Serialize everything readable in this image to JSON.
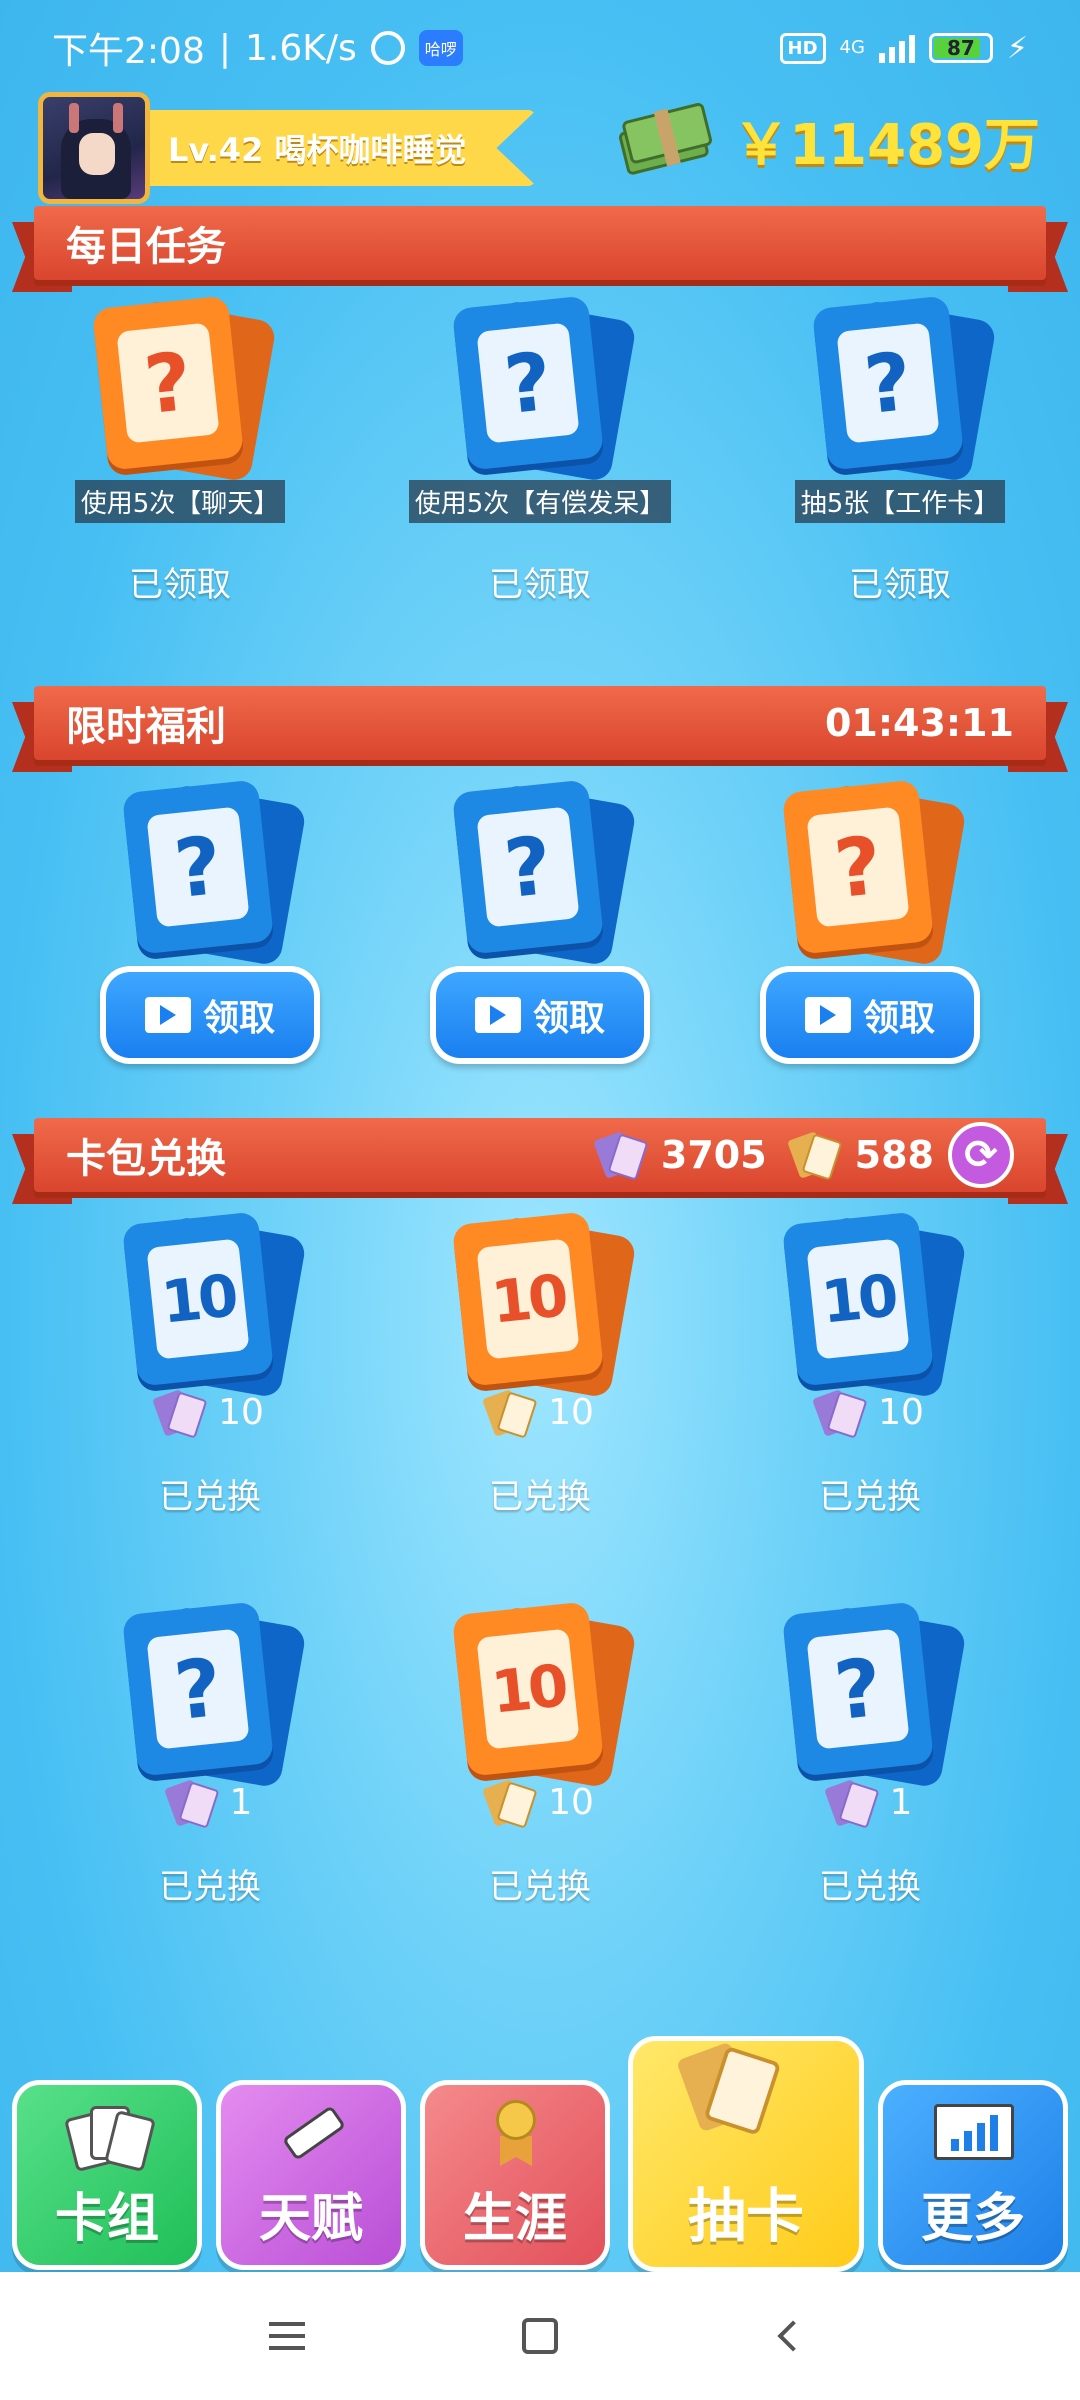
{
  "status_bar": {
    "time": "下午2:08",
    "speed": "1.6K/s",
    "app_badge": "哈啰",
    "hd": "HD",
    "network": "4G",
    "battery": "87",
    "battery_level": 0.87
  },
  "profile": {
    "level_name": "Lv.42 喝杯咖啡睡觉"
  },
  "money": {
    "amount": "￥11489万"
  },
  "daily_tasks": {
    "title": "每日任务",
    "items": [
      {
        "card_color": "orange",
        "card_symbol": "?",
        "label": "使用5次【聊天】",
        "status": "已领取"
      },
      {
        "card_color": "blue",
        "card_symbol": "?",
        "label": "使用5次【有偿发呆】",
        "status": "已领取"
      },
      {
        "card_color": "blue",
        "card_symbol": "?",
        "label": "抽5张【工作卡】",
        "status": "已领取"
      }
    ]
  },
  "limited_welfare": {
    "title": "限时福利",
    "timer": "01:43:11",
    "items": [
      {
        "card_color": "blue",
        "card_symbol": "?",
        "button": "领取"
      },
      {
        "card_color": "blue",
        "card_symbol": "?",
        "button": "领取"
      },
      {
        "card_color": "orange",
        "card_symbol": "?",
        "button": "领取"
      }
    ]
  },
  "pack_exchange": {
    "title": "卡包兑换",
    "purple_tickets": "3705",
    "gold_tickets": "588",
    "refresh_icon": "refresh-icon",
    "items": [
      {
        "card_color": "blue",
        "card_symbol": "10",
        "ticket": "purple",
        "cost": "10",
        "status": "已兑换"
      },
      {
        "card_color": "orange",
        "card_symbol": "10",
        "ticket": "gold",
        "cost": "10",
        "status": "已兑换"
      },
      {
        "card_color": "blue",
        "card_symbol": "10",
        "ticket": "purple",
        "cost": "10",
        "status": "已兑换"
      },
      {
        "card_color": "blue",
        "card_symbol": "?",
        "ticket": "purple",
        "cost": "1",
        "status": "已兑换"
      },
      {
        "card_color": "orange",
        "card_symbol": "10",
        "ticket": "gold",
        "cost": "10",
        "status": "已兑换"
      },
      {
        "card_color": "blue",
        "card_symbol": "?",
        "ticket": "purple",
        "cost": "1",
        "status": "已兑换"
      }
    ]
  },
  "bottom_nav": {
    "cards": "卡组",
    "talent": "天赋",
    "career": "生涯",
    "draw": "抽卡",
    "more": "更多"
  },
  "colors": {
    "banner_red": "#d9452e",
    "money_yellow": "#ffe23a",
    "accent_blue": "#1a7ff0"
  }
}
